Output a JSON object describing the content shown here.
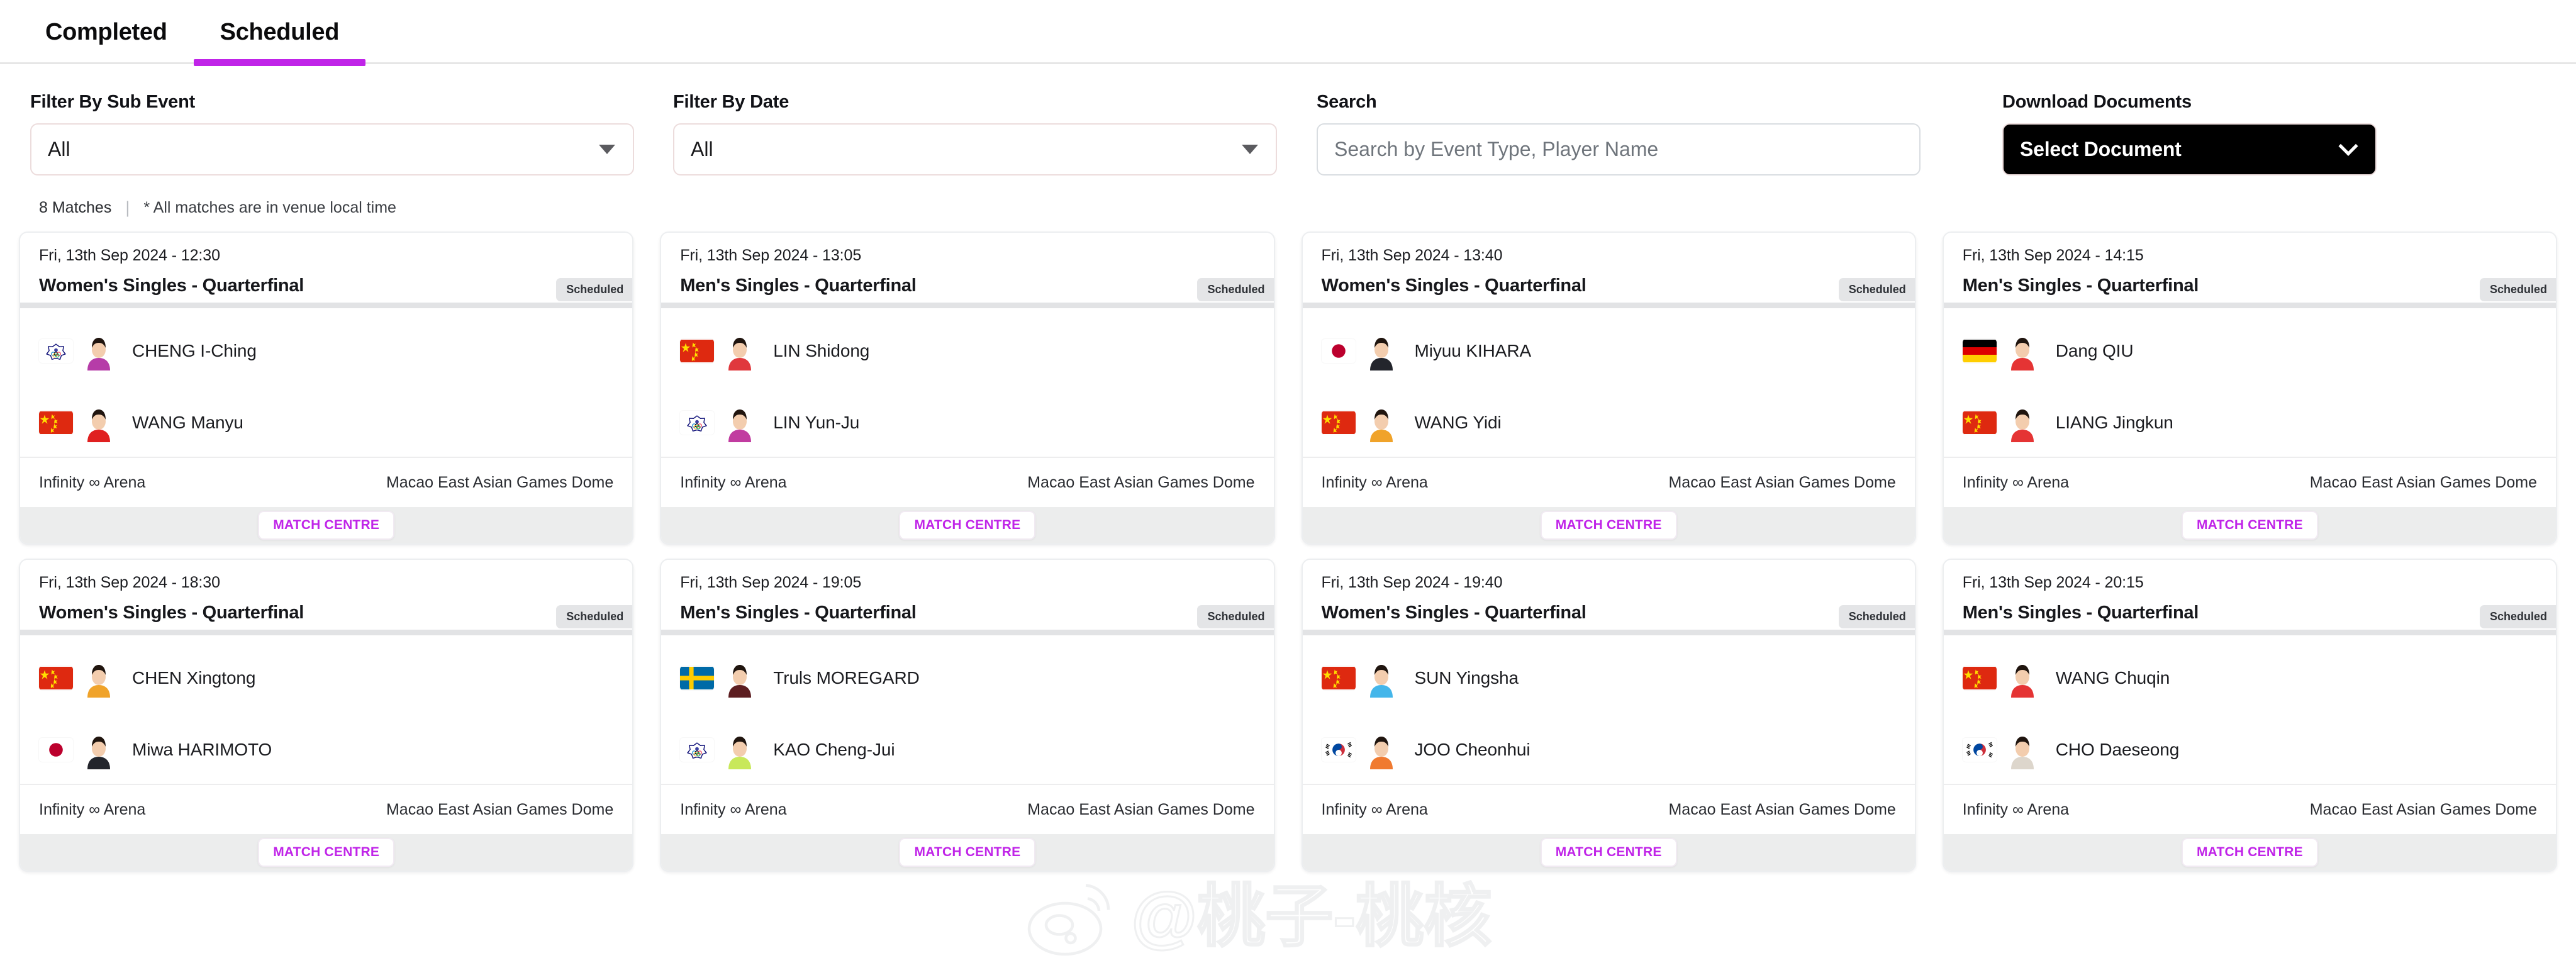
{
  "tabs": [
    {
      "label": "Completed",
      "active": false
    },
    {
      "label": "Scheduled",
      "active": true
    }
  ],
  "filters": {
    "sub_event": {
      "label": "Filter By Sub Event",
      "value": "All",
      "icon": "chevron-down-icon"
    },
    "date": {
      "label": "Filter By Date",
      "value": "All",
      "icon": "chevron-down-icon"
    },
    "search": {
      "label": "Search",
      "placeholder": "Search by Event Type, Player Name",
      "value": ""
    },
    "download": {
      "label": "Download Documents",
      "value": "Select Document",
      "icon": "chevron-down-icon"
    }
  },
  "meta": {
    "count": "8 Matches",
    "separator": "|",
    "note": "* All matches are in venue local time"
  },
  "card_labels": {
    "status": "Scheduled",
    "match_centre": "MATCH CENTRE"
  },
  "colors": {
    "accent": "#c024e8",
    "badge_bg": "#e4e5e7",
    "footer_bg": "#eceded",
    "download_bg": "#000000"
  },
  "watermark": {
    "text": "@桃子-桃核",
    "icon": "weibo-logo-icon"
  },
  "matches": [
    {
      "date": "Fri, 13th Sep 2024 - 12:30",
      "title": "Women's Singles - Quarterfinal",
      "status": "Scheduled",
      "venue": "Infinity ∞ Arena",
      "location": "Macao East Asian Games Dome",
      "players": [
        {
          "name": "CHENG I-Ching",
          "flag": "TPE",
          "kit": "#b63ca8"
        },
        {
          "name": "WANG Manyu",
          "flag": "CHN",
          "kit": "#e02020"
        }
      ]
    },
    {
      "date": "Fri, 13th Sep 2024 - 13:05",
      "title": "Men's Singles - Quarterfinal",
      "status": "Scheduled",
      "venue": "Infinity ∞ Arena",
      "location": "Macao East Asian Games Dome",
      "players": [
        {
          "name": "LIN Shidong",
          "flag": "CHN",
          "kit": "#e0383d"
        },
        {
          "name": "LIN Yun-Ju",
          "flag": "TPE",
          "kit": "#c13ca0"
        }
      ]
    },
    {
      "date": "Fri, 13th Sep 2024 - 13:40",
      "title": "Women's Singles - Quarterfinal",
      "status": "Scheduled",
      "venue": "Infinity ∞ Arena",
      "location": "Macao East Asian Games Dome",
      "players": [
        {
          "name": "Miyuu KIHARA",
          "flag": "JPN",
          "kit": "#23252c"
        },
        {
          "name": "WANG Yidi",
          "flag": "CHN",
          "kit": "#f0a32a"
        }
      ]
    },
    {
      "date": "Fri, 13th Sep 2024 - 14:15",
      "title": "Men's Singles - Quarterfinal",
      "status": "Scheduled",
      "venue": "Infinity ∞ Arena",
      "location": "Macao East Asian Games Dome",
      "players": [
        {
          "name": "Dang QIU",
          "flag": "GER",
          "kit": "#e53434"
        },
        {
          "name": "LIANG Jingkun",
          "flag": "CHN",
          "kit": "#e53434"
        }
      ]
    },
    {
      "date": "Fri, 13th Sep 2024 - 18:30",
      "title": "Women's Singles - Quarterfinal",
      "status": "Scheduled",
      "venue": "Infinity ∞ Arena",
      "location": "Macao East Asian Games Dome",
      "players": [
        {
          "name": "CHEN Xingtong",
          "flag": "CHN",
          "kit": "#f0a32a"
        },
        {
          "name": "Miwa HARIMOTO",
          "flag": "JPN",
          "kit": "#23252c"
        }
      ]
    },
    {
      "date": "Fri, 13th Sep 2024 - 19:05",
      "title": "Men's Singles - Quarterfinal",
      "status": "Scheduled",
      "venue": "Infinity ∞ Arena",
      "location": "Macao East Asian Games Dome",
      "players": [
        {
          "name": "Truls MOREGARD",
          "flag": "SWE",
          "kit": "#5c1d20"
        },
        {
          "name": "KAO Cheng-Jui",
          "flag": "TPE",
          "kit": "#c8e85a"
        }
      ]
    },
    {
      "date": "Fri, 13th Sep 2024 - 19:40",
      "title": "Women's Singles - Quarterfinal",
      "status": "Scheduled",
      "venue": "Infinity ∞ Arena",
      "location": "Macao East Asian Games Dome",
      "players": [
        {
          "name": "SUN Yingsha",
          "flag": "CHN",
          "kit": "#44b6ea"
        },
        {
          "name": "JOO Cheonhui",
          "flag": "KOR",
          "kit": "#f07a30"
        }
      ]
    },
    {
      "date": "Fri, 13th Sep 2024 - 20:15",
      "title": "Men's Singles - Quarterfinal",
      "status": "Scheduled",
      "venue": "Infinity ∞ Arena",
      "location": "Macao East Asian Games Dome",
      "players": [
        {
          "name": "WANG Chuqin",
          "flag": "CHN",
          "kit": "#e53434"
        },
        {
          "name": "CHO Daeseong",
          "flag": "KOR",
          "kit": "#ddd6cc"
        }
      ]
    }
  ]
}
